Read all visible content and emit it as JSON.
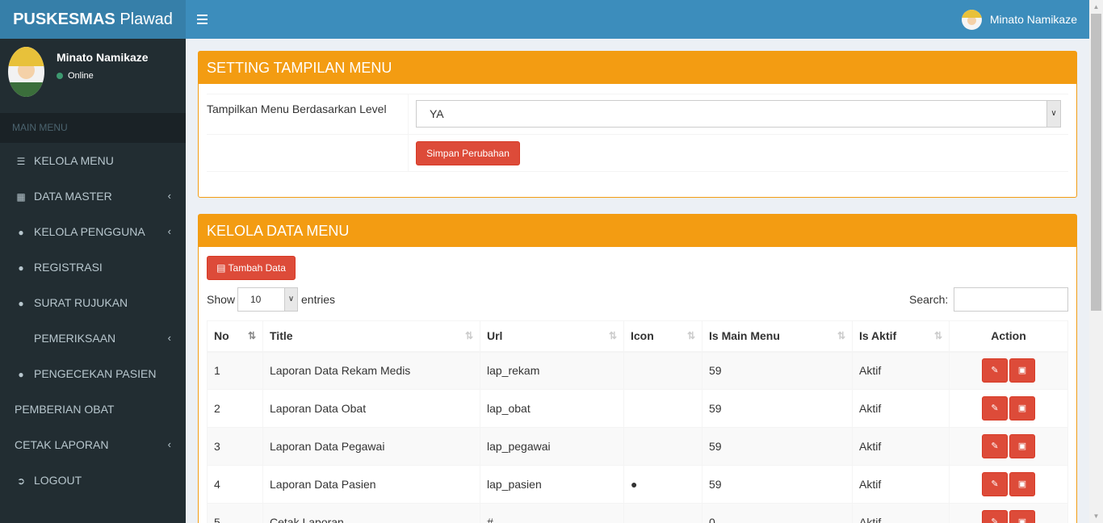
{
  "app": {
    "brand_bold": "PUSKESMAS",
    "brand_rest": " Plawad"
  },
  "header": {
    "user_name": "Minato Namikaze"
  },
  "sidebar": {
    "user_name": "Minato Namikaze",
    "user_status": "Online",
    "menu_header": "MAIN MENU",
    "items": [
      {
        "label": "KELOLA MENU",
        "icon": "list-icon",
        "has_submenu": false
      },
      {
        "label": "DATA MASTER",
        "icon": "id-card-icon",
        "has_submenu": true
      },
      {
        "label": "KELOLA PENGGUNA",
        "icon": "user-icon",
        "has_submenu": true
      },
      {
        "label": "REGISTRASI",
        "icon": "user-icon",
        "has_submenu": false
      },
      {
        "label": "SURAT RUJUKAN",
        "icon": "user-icon",
        "has_submenu": false
      },
      {
        "label": "PEMERIKSAAN",
        "icon": "",
        "has_submenu": true
      },
      {
        "label": "PENGECEKAN PASIEN",
        "icon": "user-icon",
        "has_submenu": false
      },
      {
        "label": "PEMBERIAN OBAT",
        "icon": "",
        "has_submenu": false
      },
      {
        "label": "CETAK LAPORAN",
        "icon": "",
        "has_submenu": true
      },
      {
        "label": "LOGOUT",
        "icon": "sign-out-icon",
        "has_submenu": false
      }
    ]
  },
  "setting": {
    "title": "SETTING TAMPILAN MENU",
    "label": "Tampilkan Menu Berdasarkan Level",
    "selected": "YA",
    "save_label": "Simpan Perubahan"
  },
  "kelola": {
    "title": "KELOLA DATA MENU",
    "add_label": "Tambah Data",
    "show_label": "Show",
    "page_length": "10",
    "entries_label": "entries",
    "search_label": "Search:",
    "columns": [
      "No",
      "Title",
      "Url",
      "Icon",
      "Is Main Menu",
      "Is Aktif",
      "Action"
    ],
    "rows": [
      {
        "no": "1",
        "title": "Laporan Data Rekam Medis",
        "url": "lap_rekam",
        "icon": "",
        "main": "59",
        "aktif": "Aktif"
      },
      {
        "no": "2",
        "title": "Laporan Data Obat",
        "url": "lap_obat",
        "icon": "",
        "main": "59",
        "aktif": "Aktif"
      },
      {
        "no": "3",
        "title": "Laporan Data Pegawai",
        "url": "lap_pegawai",
        "icon": "",
        "main": "59",
        "aktif": "Aktif"
      },
      {
        "no": "4",
        "title": "Laporan Data Pasien",
        "url": "lap_pasien",
        "icon": "user-icon",
        "main": "59",
        "aktif": "Aktif"
      },
      {
        "no": "5",
        "title": "Cetak Laporan",
        "url": "#",
        "icon": "",
        "main": "0",
        "aktif": "Aktif"
      }
    ]
  },
  "colors": {
    "header": "#3c8dbc",
    "logo": "#367fa9",
    "sidebar": "#222d32",
    "warning": "#f39c12",
    "danger": "#dd4b39"
  }
}
